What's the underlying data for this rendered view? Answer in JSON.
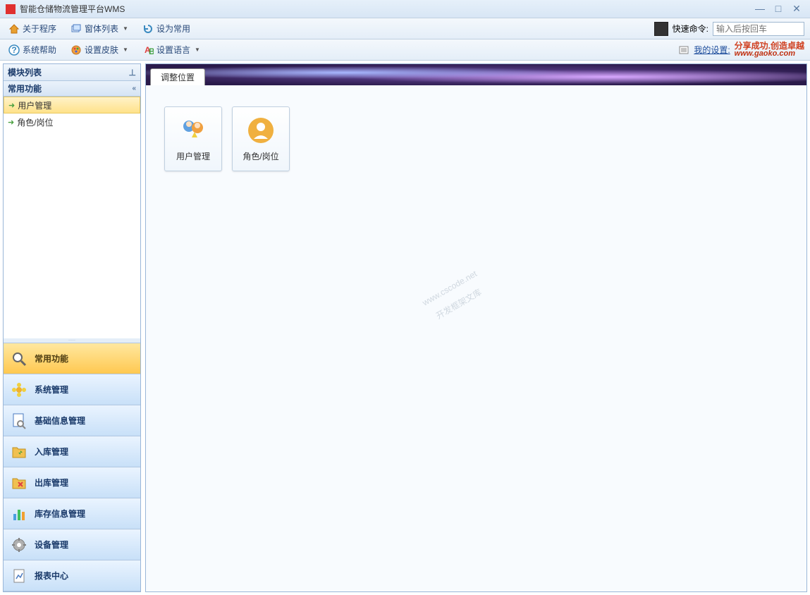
{
  "window": {
    "title": "智能仓储物流管理平台WMS"
  },
  "toolbar1": {
    "about": "关于程序",
    "windowList": "窗体列表",
    "setDefault": "设为常用",
    "quickCmdLabel": "快速命令:",
    "quickCmdPlaceholder": "输入后按回车"
  },
  "toolbar2": {
    "sysHelp": "系统帮助",
    "setSkin": "设置皮肤",
    "setLang": "设置语言",
    "mySettings": "我的设置:",
    "slogan1": "分享成功.创造卓越",
    "slogan2": "www.gaoko.com"
  },
  "sidebar": {
    "panelTitle": "模块列表",
    "groupTitle": "常用功能",
    "items": [
      {
        "label": "用户管理"
      },
      {
        "label": "角色/岗位"
      }
    ],
    "nav": [
      {
        "label": "常用功能"
      },
      {
        "label": "系统管理"
      },
      {
        "label": "基础信息管理"
      },
      {
        "label": "入库管理"
      },
      {
        "label": "出库管理"
      },
      {
        "label": "库存信息管理"
      },
      {
        "label": "设备管理"
      },
      {
        "label": "报表中心"
      }
    ]
  },
  "content": {
    "tabLabel": "调整位置",
    "tiles": [
      {
        "label": "用户管理"
      },
      {
        "label": "角色/岗位"
      }
    ],
    "watermark1": "www.cscode.net",
    "watermark2": "开发框架文库"
  }
}
